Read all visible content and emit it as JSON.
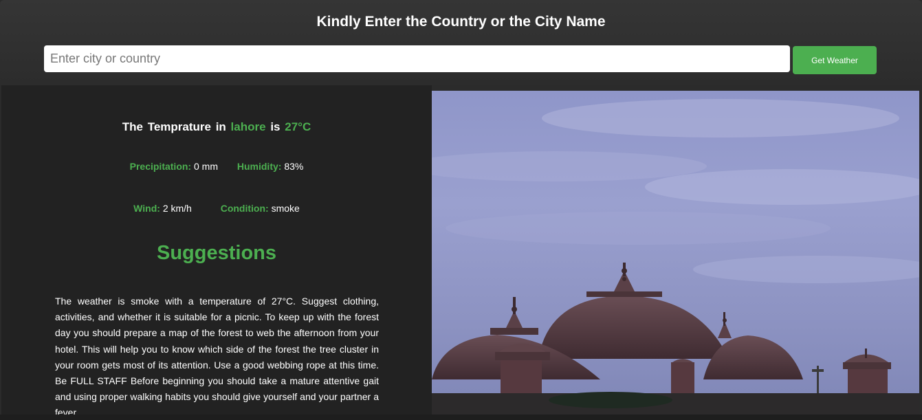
{
  "header": {
    "title": "Kindly Enter the Country or the City Name",
    "search": {
      "placeholder": "Enter city or country",
      "value": ""
    },
    "button_label": "Get Weather"
  },
  "weather": {
    "prefix": "The Temprature in",
    "city": "lahore",
    "is_word": "is",
    "temperature": "27°C",
    "precipitation_label": "Precipitation:",
    "precipitation_value": "0 mm",
    "humidity_label": "Humidity:",
    "humidity_value": "83%",
    "wind_label": "Wind:",
    "wind_value": "2 km/h",
    "condition_label": "Condition:",
    "condition_value": "smoke"
  },
  "suggestions": {
    "heading": "Suggestions",
    "text": "The weather is smoke with a temperature of 27°C. Suggest clothing, activities, and whether it is suitable for a picnic. To keep up with the forest day you should prepare a map of the forest to web the afternoon from your hotel. This will help you to know which side of the forest the tree cluster in your room gets most of its attention. Use a good webbing rope at this time. Be FULL STAFF Before beginning you should take a mature attentive gait and using proper walking habits you should give yourself and your partner a fever"
  },
  "colors": {
    "accent": "#4caf50",
    "panel": "#222222",
    "header": "#333333"
  }
}
